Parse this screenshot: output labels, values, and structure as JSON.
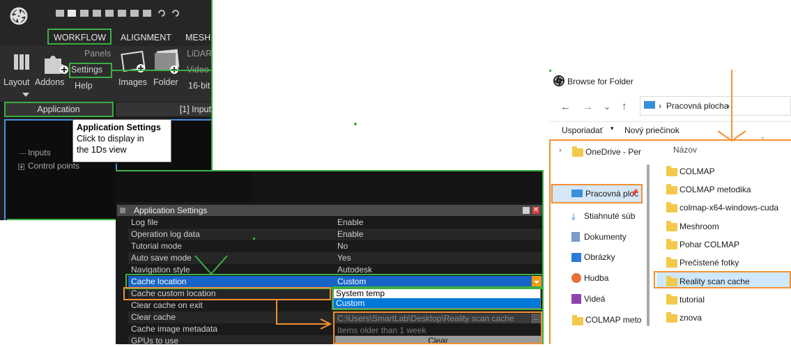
{
  "realityscan": {
    "menu_tabs": [
      "WORKFLOW",
      "ALIGNMENT",
      "MESH"
    ],
    "ribbon": {
      "panels_label": "Panels",
      "settings_label": "Settings",
      "help_label": "Help",
      "layout_label": "Layout",
      "addons_label": "Addons",
      "images_label": "Images",
      "folder_label": "Folder",
      "lidar_label": "LiDAR",
      "video_label": "Video",
      "bit_label": "16-bit"
    },
    "group_bar": {
      "application": "Application",
      "input": "[1] Input"
    },
    "tooltip": {
      "title": "Application Settings",
      "line1": "Click to display in",
      "line2": "the 1Ds view"
    },
    "tree": {
      "inputs": "Inputs",
      "control_points": "Control points"
    }
  },
  "settings_panel": {
    "title": "Application Settings",
    "rows": [
      {
        "key": "Log file",
        "value": "Enable"
      },
      {
        "key": "Operation log data",
        "value": "Enable"
      },
      {
        "key": "Tutorial mode",
        "value": "No"
      },
      {
        "key": "Auto save mode",
        "value": "Yes"
      },
      {
        "key": "Navigation style",
        "value": "Autodesk"
      },
      {
        "key": "Cache location",
        "value": "Custom"
      },
      {
        "key": "Cache custom location",
        "value": ""
      },
      {
        "key": "Clear cache on exit",
        "value": ""
      },
      {
        "key": "Clear cache",
        "value": ""
      },
      {
        "key": "Cache image metadata",
        "value": ""
      },
      {
        "key": "GPUs to use",
        "value": ""
      }
    ],
    "dropdown_options": [
      "System temp",
      "Custom"
    ],
    "dropdown_selected": "Custom",
    "cache_path": "C:\\Users\\SmartLab\\Desktop\\Reality scan cache",
    "clear_on_exit_value": "Items older than 1 week",
    "clear_button": "Clear"
  },
  "browse_dialog": {
    "title": "Browse for Folder",
    "breadcrumb": "Pracovná plocha",
    "toolbar": {
      "organize": "Usporiadať",
      "new_folder": "Nový priečinok"
    },
    "nav": [
      {
        "label": "OneDrive - Perso"
      },
      {
        "label": "Pracovná ploc"
      },
      {
        "label": "Stiahnuté súb"
      },
      {
        "label": "Dokumenty"
      },
      {
        "label": "Obrázky"
      },
      {
        "label": "Hudba"
      },
      {
        "label": "Videá"
      },
      {
        "label": "COLMAP metodi"
      }
    ],
    "column_header": "Názov",
    "folders": [
      "COLMAP",
      "COLMAP metodika",
      "colmap-x64-windows-cuda",
      "Meshroom",
      "Pohar COLMAP",
      "Prečistené fotky",
      "Reality scan cache",
      "tutorial",
      "znova"
    ],
    "selected_folder": "Reality scan cache"
  },
  "colors": {
    "highlight_green": "#3cb043",
    "highlight_orange": "#f39032",
    "selection_blue": "#1664c8"
  }
}
